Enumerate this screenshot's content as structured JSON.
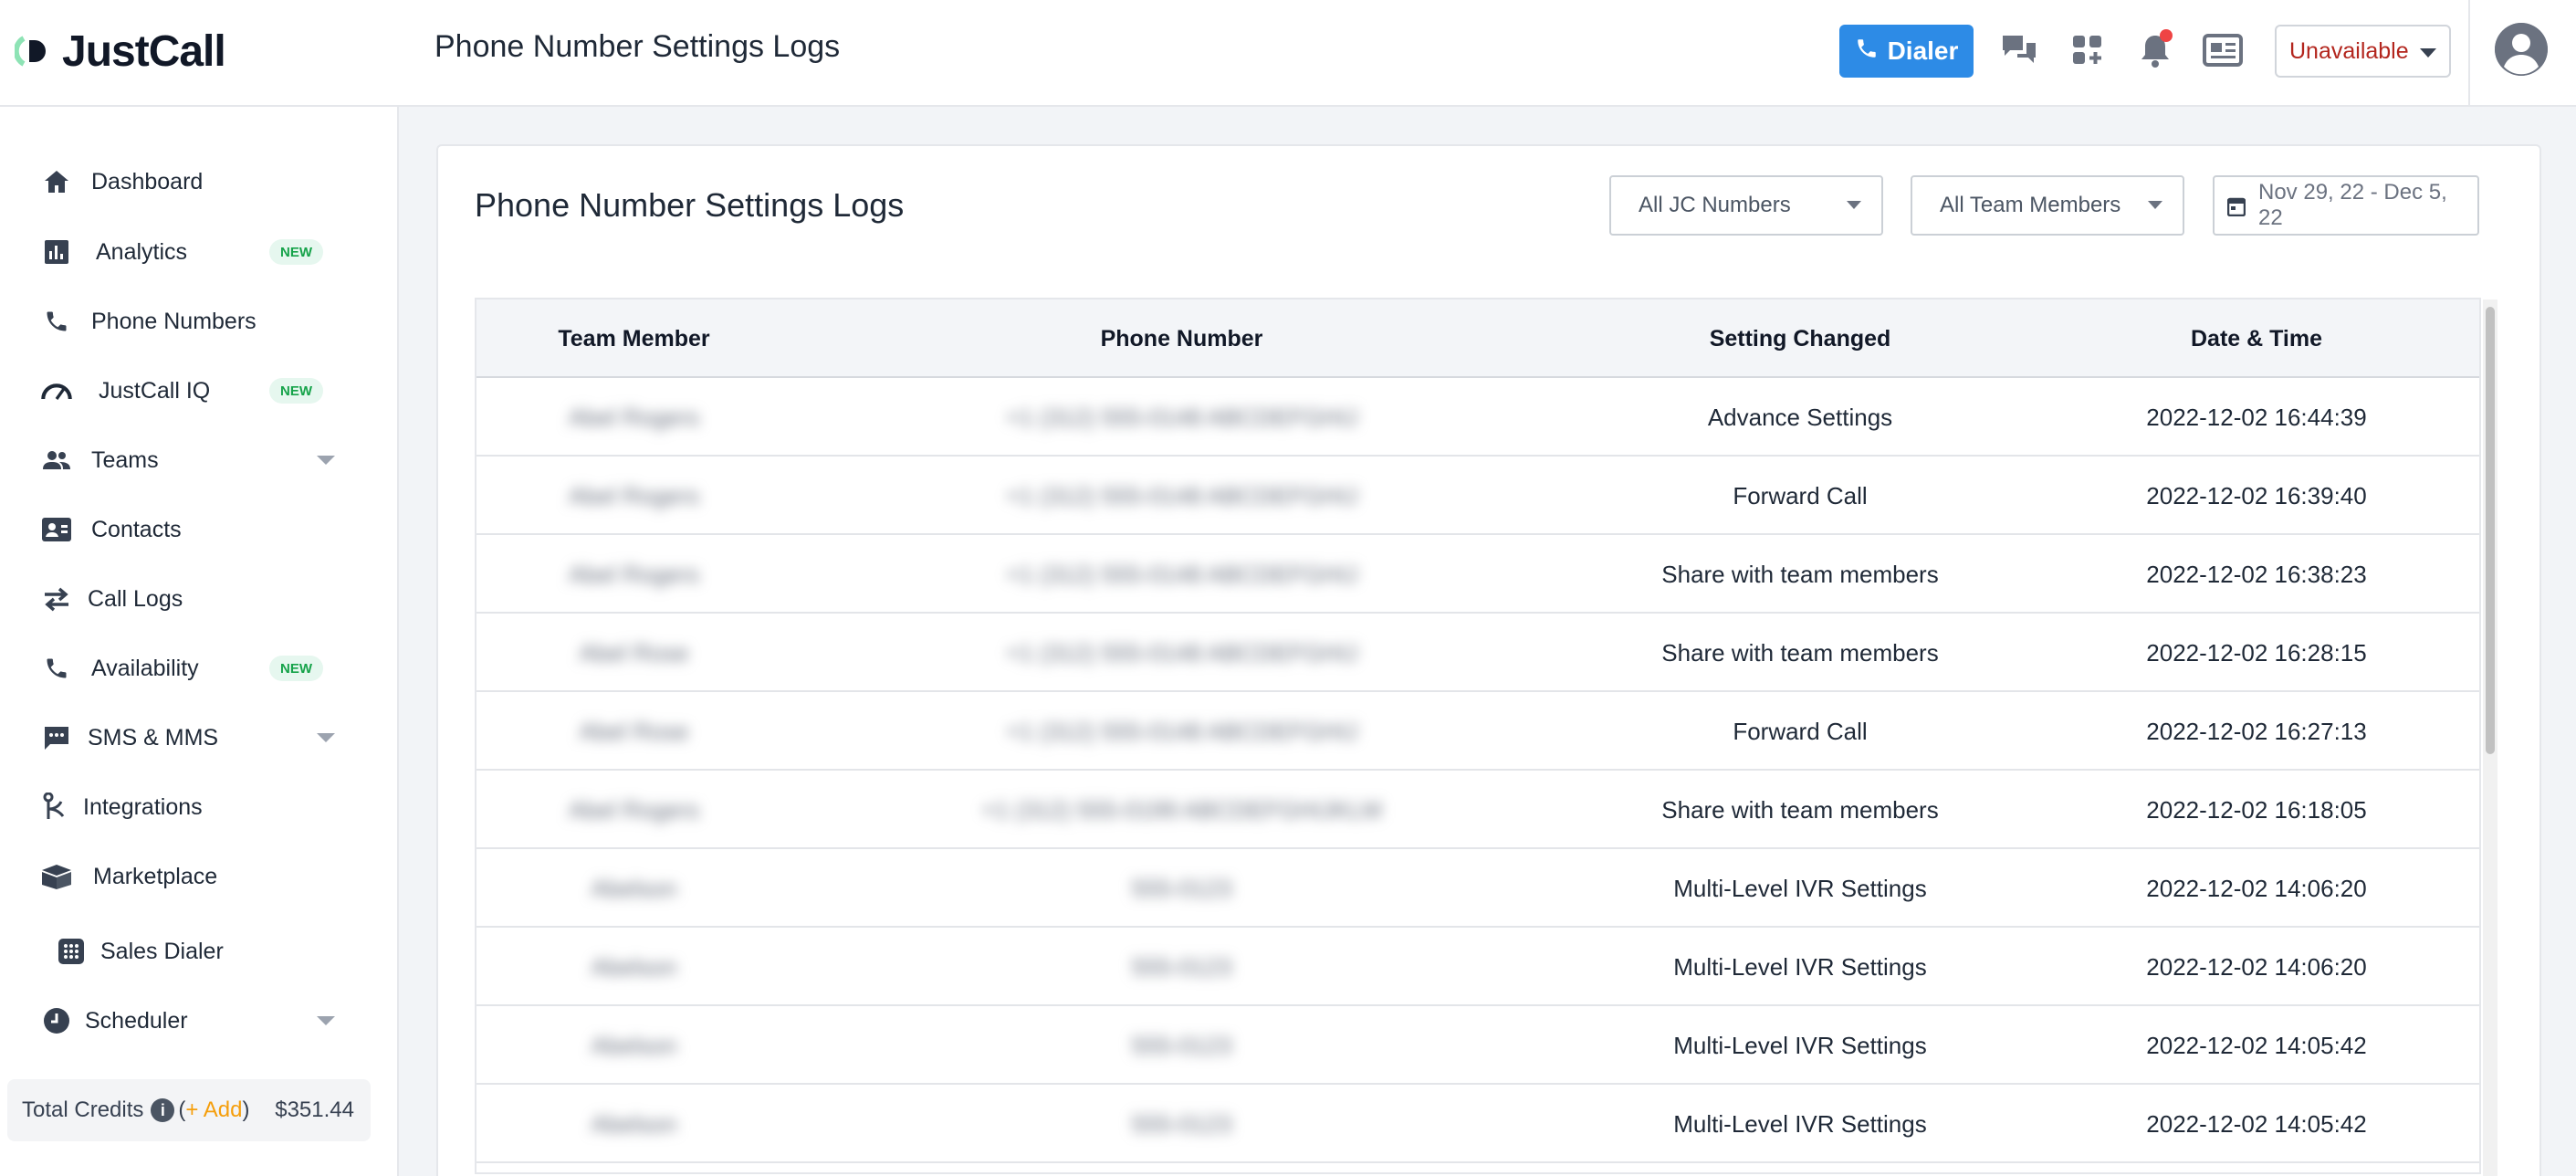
{
  "app": {
    "logo_text": "JustCall",
    "page_title": "Phone Number Settings Logs"
  },
  "topbar": {
    "dialer_label": "Dialer",
    "status": "Unavailable",
    "icons": [
      "chat-icon",
      "apps-icon",
      "bell-icon",
      "news-icon",
      "user-icon"
    ]
  },
  "sidebar": {
    "items": [
      {
        "label": "Dashboard",
        "icon": "home-icon"
      },
      {
        "label": "Analytics",
        "icon": "bar-chart-icon",
        "badge": "NEW"
      },
      {
        "label": "Phone Numbers",
        "icon": "phone-icon"
      },
      {
        "label": "JustCall IQ",
        "icon": "gauge-icon",
        "badge": "NEW"
      },
      {
        "label": "Teams",
        "icon": "people-icon",
        "expandable": true
      },
      {
        "label": "Contacts",
        "icon": "contact-card-icon"
      },
      {
        "label": "Call Logs",
        "icon": "swap-arrows-icon"
      },
      {
        "label": "Availability",
        "icon": "phone-icon",
        "badge": "NEW"
      },
      {
        "label": "SMS & MMS",
        "icon": "message-icon",
        "expandable": true
      },
      {
        "label": "Integrations",
        "icon": "integration-icon"
      },
      {
        "label": "Marketplace",
        "icon": "box-icon"
      },
      {
        "label": "Sales Dialer",
        "icon": "dialpad-icon"
      },
      {
        "label": "Scheduler",
        "icon": "clock-icon",
        "expandable": true
      }
    ],
    "credits": {
      "label": "Total Credits",
      "add_label": "+ Add",
      "amount": "$351.44"
    }
  },
  "main": {
    "card_title": "Phone Number Settings Logs",
    "filters": {
      "numbers": "All JC Numbers",
      "members": "All Team Members",
      "date_range": "Nov 29, 22 - Dec 5, 22"
    },
    "table": {
      "columns": [
        "Team Member",
        "Phone Number",
        "Setting Changed",
        "Date & Time"
      ],
      "rows": [
        {
          "member": "Abel Rogers",
          "phone": "+1 (312) 555-0148 ABCDEFGHIJ",
          "setting": "Advance Settings",
          "datetime": "2022-12-02 16:44:39"
        },
        {
          "member": "Abel Rogers",
          "phone": "+1 (312) 555-0148 ABCDEFGHIJ",
          "setting": "Forward Call",
          "datetime": "2022-12-02 16:39:40"
        },
        {
          "member": "Abel Rogers",
          "phone": "+1 (312) 555-0148 ABCDEFGHIJ",
          "setting": "Share with team members",
          "datetime": "2022-12-02 16:38:23"
        },
        {
          "member": "Abel Rose",
          "phone": "+1 (312) 555-0148 ABCDEFGHIJ",
          "setting": "Share with team members",
          "datetime": "2022-12-02 16:28:15"
        },
        {
          "member": "Abel Rose",
          "phone": "+1 (312) 555-0148 ABCDEFGHIJ",
          "setting": "Forward Call",
          "datetime": "2022-12-02 16:27:13"
        },
        {
          "member": "Abel Rogers",
          "phone": "+1 (312) 555-0199 ABCDEFGHIJKLM",
          "setting": "Share with team members",
          "datetime": "2022-12-02 16:18:05"
        },
        {
          "member": "Abelson",
          "phone": "555-0123",
          "setting": "Multi-Level IVR Settings",
          "datetime": "2022-12-02 14:06:20"
        },
        {
          "member": "Abelson",
          "phone": "555-0123",
          "setting": "Multi-Level IVR Settings",
          "datetime": "2022-12-02 14:06:20"
        },
        {
          "member": "Abelson",
          "phone": "555-0123",
          "setting": "Multi-Level IVR Settings",
          "datetime": "2022-12-02 14:05:42"
        },
        {
          "member": "Abelson",
          "phone": "555-0123",
          "setting": "Multi-Level IVR Settings",
          "datetime": "2022-12-02 14:05:42"
        }
      ]
    }
  },
  "colors": {
    "accent": "#2d8be6",
    "status_unavailable": "#b3261e",
    "badge_bg": "#e6f7ef",
    "badge_text": "#16a34a",
    "notification": "#ef4444"
  }
}
